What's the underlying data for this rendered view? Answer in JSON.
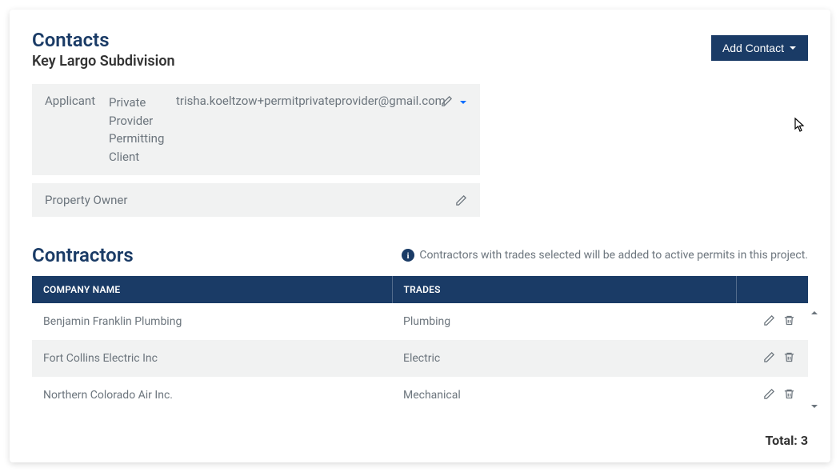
{
  "contacts": {
    "title": "Contacts",
    "subtitle": "Key Largo Subdivision",
    "add_button": "Add Contact",
    "rows": [
      {
        "label": "Applicant",
        "name": "Private Provider Permitting Client",
        "email": "trisha.koeltzow+permitprivateprovider@gmail.com"
      },
      {
        "label": "Property Owner",
        "name": "",
        "email": ""
      }
    ]
  },
  "contractors": {
    "title": "Contractors",
    "hint": "Contractors with trades selected will be added to active permits in this project.",
    "columns": {
      "company": "COMPANY NAME",
      "trades": "TRADES"
    },
    "rows": [
      {
        "company": "Benjamin Franklin Plumbing",
        "trade": "Plumbing"
      },
      {
        "company": "Fort Collins Electric Inc",
        "trade": "Electric"
      },
      {
        "company": "Northern Colorado Air Inc.",
        "trade": "Mechanical"
      }
    ],
    "total_label": "Total:",
    "total_value": "3"
  }
}
